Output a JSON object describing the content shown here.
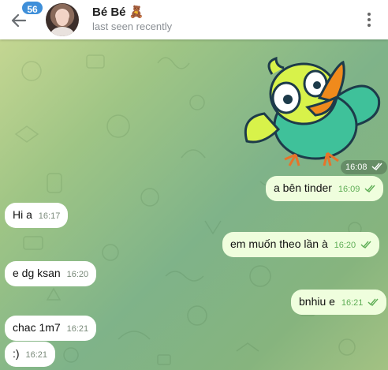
{
  "header": {
    "badge_count": "56",
    "contact_name": "Bé Bé 🧸",
    "status": "last seen recently"
  },
  "messages": [
    {
      "text": "",
      "time": "16:08",
      "type": "sticker",
      "direction": "out"
    },
    {
      "text": "a bên tinder",
      "time": "16:09",
      "direction": "out"
    },
    {
      "text": "Hi a",
      "time": "16:17",
      "direction": "in"
    },
    {
      "text": "em muốn theo lần à",
      "time": "16:20",
      "direction": "out"
    },
    {
      "text": "e dg ksan",
      "time": "16:20",
      "direction": "in"
    },
    {
      "text": "bnhiu e",
      "time": "16:21",
      "direction": "out"
    },
    {
      "text": "chac 1m7",
      "time": "16:21",
      "direction": "in"
    },
    {
      "text": ":)",
      "time": "16:21",
      "direction": "in"
    }
  ],
  "colors": {
    "badge": "#3f8fd9",
    "outgoing_bubble": "#effedd",
    "incoming_bubble": "#ffffff",
    "read_checks": "#5fae56"
  },
  "icons": [
    "back-arrow-icon",
    "more-vertical-icon",
    "double-check-icon"
  ]
}
